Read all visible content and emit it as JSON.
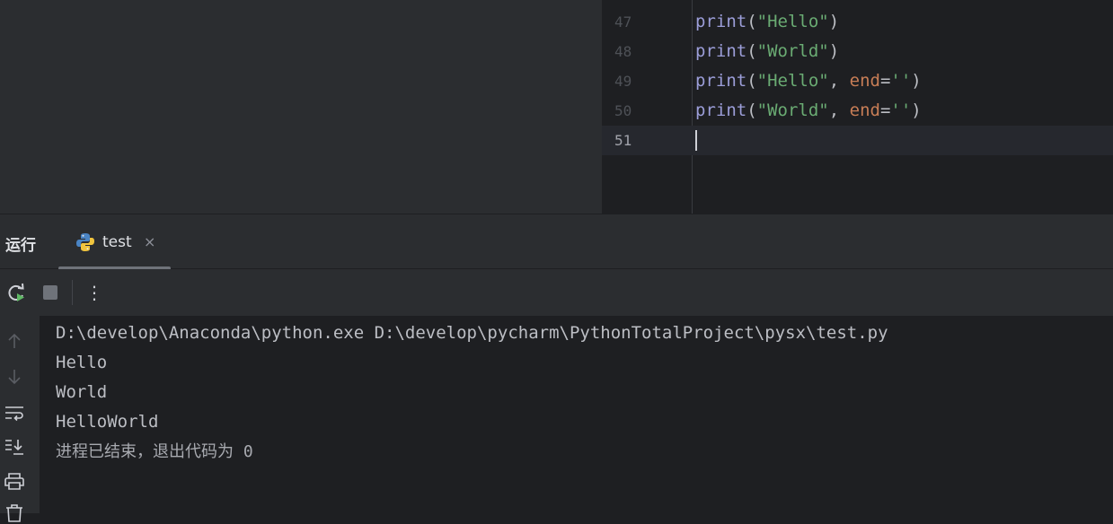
{
  "editor": {
    "lines": [
      {
        "num": "47",
        "fn": "print",
        "open": "(",
        "str": "\"Hello\"",
        "sep": "",
        "kw": "",
        "eq": "",
        "val": "",
        "close": ")"
      },
      {
        "num": "48",
        "fn": "print",
        "open": "(",
        "str": "\"World\"",
        "sep": "",
        "kw": "",
        "eq": "",
        "val": "",
        "close": ")"
      },
      {
        "num": "49",
        "fn": "print",
        "open": "(",
        "str": "\"Hello\"",
        "sep": ", ",
        "kw": "end",
        "eq": "=",
        "val": "''",
        "close": ")"
      },
      {
        "num": "50",
        "fn": "print",
        "open": "(",
        "str": "\"World\"",
        "sep": ", ",
        "kw": "end",
        "eq": "=",
        "val": "''",
        "close": ")"
      },
      {
        "num": "51",
        "fn": "",
        "open": "",
        "str": "",
        "sep": "",
        "kw": "",
        "eq": "",
        "val": "",
        "close": ""
      }
    ]
  },
  "run_panel": {
    "title": "运行",
    "tab": {
      "label": "test",
      "close": "×",
      "icon": "python-icon"
    }
  },
  "toolbar": {
    "rerun_icon": "rerun-icon",
    "stop_icon": "stop-icon",
    "more_label": "⋮"
  },
  "side_icons": [
    "scroll-up-icon",
    "scroll-down-icon",
    "soft-wrap-icon",
    "scroll-to-end-icon",
    "print-icon",
    "clear-icon"
  ],
  "console": {
    "lines": [
      "D:\\develop\\Anaconda\\python.exe D:\\develop\\pycharm\\PythonTotalProject\\pysx\\test.py",
      "Hello",
      "World",
      "HelloWorld",
      "进程已结束，退出代码为 0"
    ]
  },
  "colors": {
    "function": "#9c9ed9",
    "string": "#6aab73",
    "keyword": "#c77d56",
    "background": "#1e1f22",
    "panel": "#2b2d30"
  }
}
